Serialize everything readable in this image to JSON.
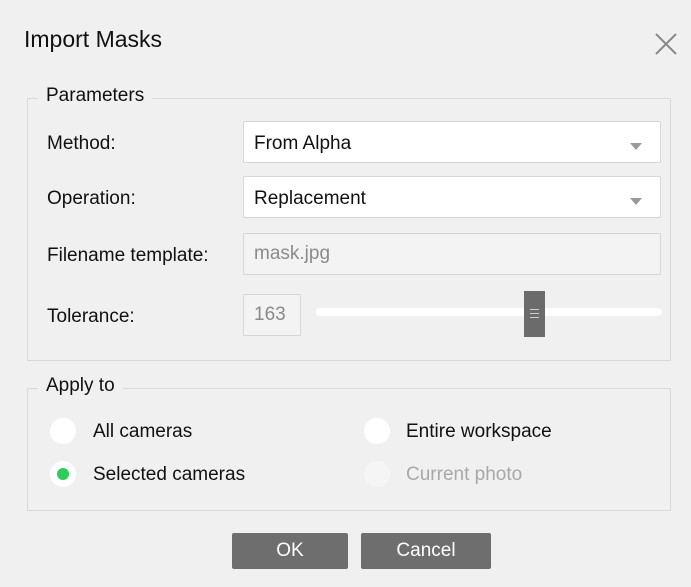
{
  "window": {
    "title": "Import Masks",
    "close_icon": "close-icon"
  },
  "parameters": {
    "legend": "Parameters",
    "method": {
      "label": "Method:",
      "value": "From Alpha"
    },
    "operation": {
      "label": "Operation:",
      "value": "Replacement"
    },
    "filename_template": {
      "label": "Filename template:",
      "value": "mask.jpg",
      "disabled": true
    },
    "tolerance": {
      "label": "Tolerance:",
      "value": "163",
      "slider_fraction": 0.64
    }
  },
  "apply_to": {
    "legend": "Apply to",
    "options": [
      {
        "label": "All cameras",
        "selected": false,
        "disabled": false
      },
      {
        "label": "Selected cameras",
        "selected": true,
        "disabled": false
      },
      {
        "label": "Entire workspace",
        "selected": false,
        "disabled": false
      },
      {
        "label": "Current photo",
        "selected": false,
        "disabled": true
      }
    ],
    "selected_color": "#2ecc5a"
  },
  "buttons": {
    "ok": "OK",
    "cancel": "Cancel"
  }
}
